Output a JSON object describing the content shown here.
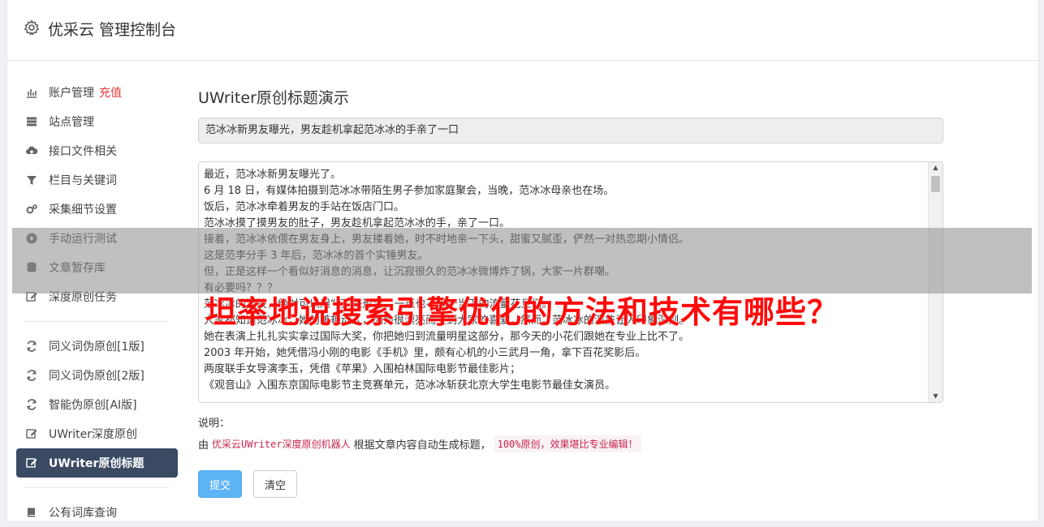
{
  "header": {
    "title": "优采云 管理控制台",
    "icon": "gear-icon"
  },
  "sidebar": {
    "groups": [
      [
        {
          "label": "账户管理",
          "badge": "充值",
          "icon": "bar-chart-icon"
        },
        {
          "label": "站点管理",
          "icon": "server-icon"
        },
        {
          "label": "接口文件相关",
          "icon": "cloud-upload-icon"
        },
        {
          "label": "栏目与关键词",
          "icon": "filter-icon"
        },
        {
          "label": "采集细节设置",
          "icon": "cogs-icon"
        },
        {
          "label": "手动运行测试",
          "icon": "play-circle-icon"
        },
        {
          "label": "文章暂存库",
          "icon": "database-icon"
        },
        {
          "label": "深度原创任务",
          "icon": "edit-icon"
        }
      ],
      [
        {
          "label": "同义词伪原创[1版]",
          "icon": "refresh-icon"
        },
        {
          "label": "同义词伪原创[2版]",
          "icon": "refresh-icon"
        },
        {
          "label": "智能伪原创[AI版]",
          "icon": "refresh-icon"
        },
        {
          "label": "UWriter深度原创",
          "icon": "edit-icon"
        },
        {
          "label": "UWriter原创标题",
          "icon": "edit-icon",
          "active": true
        }
      ],
      [
        {
          "label": "公有词库查询",
          "icon": "book-icon"
        }
      ]
    ]
  },
  "main": {
    "heading": "UWriter原创标题演示",
    "title_value": "范冰冰新男友曝光，男友趁机拿起范冰冰的手亲了一口",
    "content_lines": [
      "最近，范冰冰新男友曝光了。",
      "6 月 18 日，有媒体拍摄到范冰冰带陌生男子参加家庭聚会，当晚，范冰冰母亲也在场。",
      "饭后，范冰冰牵着男友的手站在饭店门口。",
      "范冰冰摸了摸男友的肚子，男友趁机拿起范冰冰的手，亲了一口。",
      "接着，范冰冰依偎在男友身上，男友搂着她，时不时地亲一下头，甜蜜又腻歪，俨然一对热恋期小情侣。",
      "这是范李分手 3 年后，范冰冰的首个实锤男友。",
      "但，正是这样一个看似好消息的消息，让沉寂很久的范冰冰微博炸了锅，大家一片群嘲。",
      "有必要吗？？？",
      "范冰冰的演技，绝对可以用“好”来形容，一点也不输于当下的流量花旦们。",
      "大家都知道范冰冰，她的美艳动人，因为很漂亮而受到大家的喜爱，然而，范冰冰的演技让人印象深刻。",
      "她在表演上扎扎实实拿过国际大奖，你把她归到流量明星这部分，那今天的小花们跟她在专业上比不了。",
      "2003 年开始，她凭借冯小刚的电影《手机》里，颇有心机的小三武月一角，拿下百花奖影后。",
      "两度联手女导演李玉，凭借《苹果》入围柏林国际电影节最佳影片；",
      "《观音山》入围东京国际电影节主竞赛单元，范冰冰斩获北京大学生电影节最佳女演员。"
    ],
    "desc_label": "说明：",
    "desc_prefix": "由",
    "desc_link": "优采云UWriter深度原创机器人",
    "desc_middle": "根据文章内容自动生成标题，",
    "desc_code": "100%原创，效果堪比专业编辑！",
    "submit_label": "提交",
    "clear_label": "清空"
  },
  "overlay": {
    "text": "坦率地说搜索引擎优化的方法和技术有哪些？"
  }
}
